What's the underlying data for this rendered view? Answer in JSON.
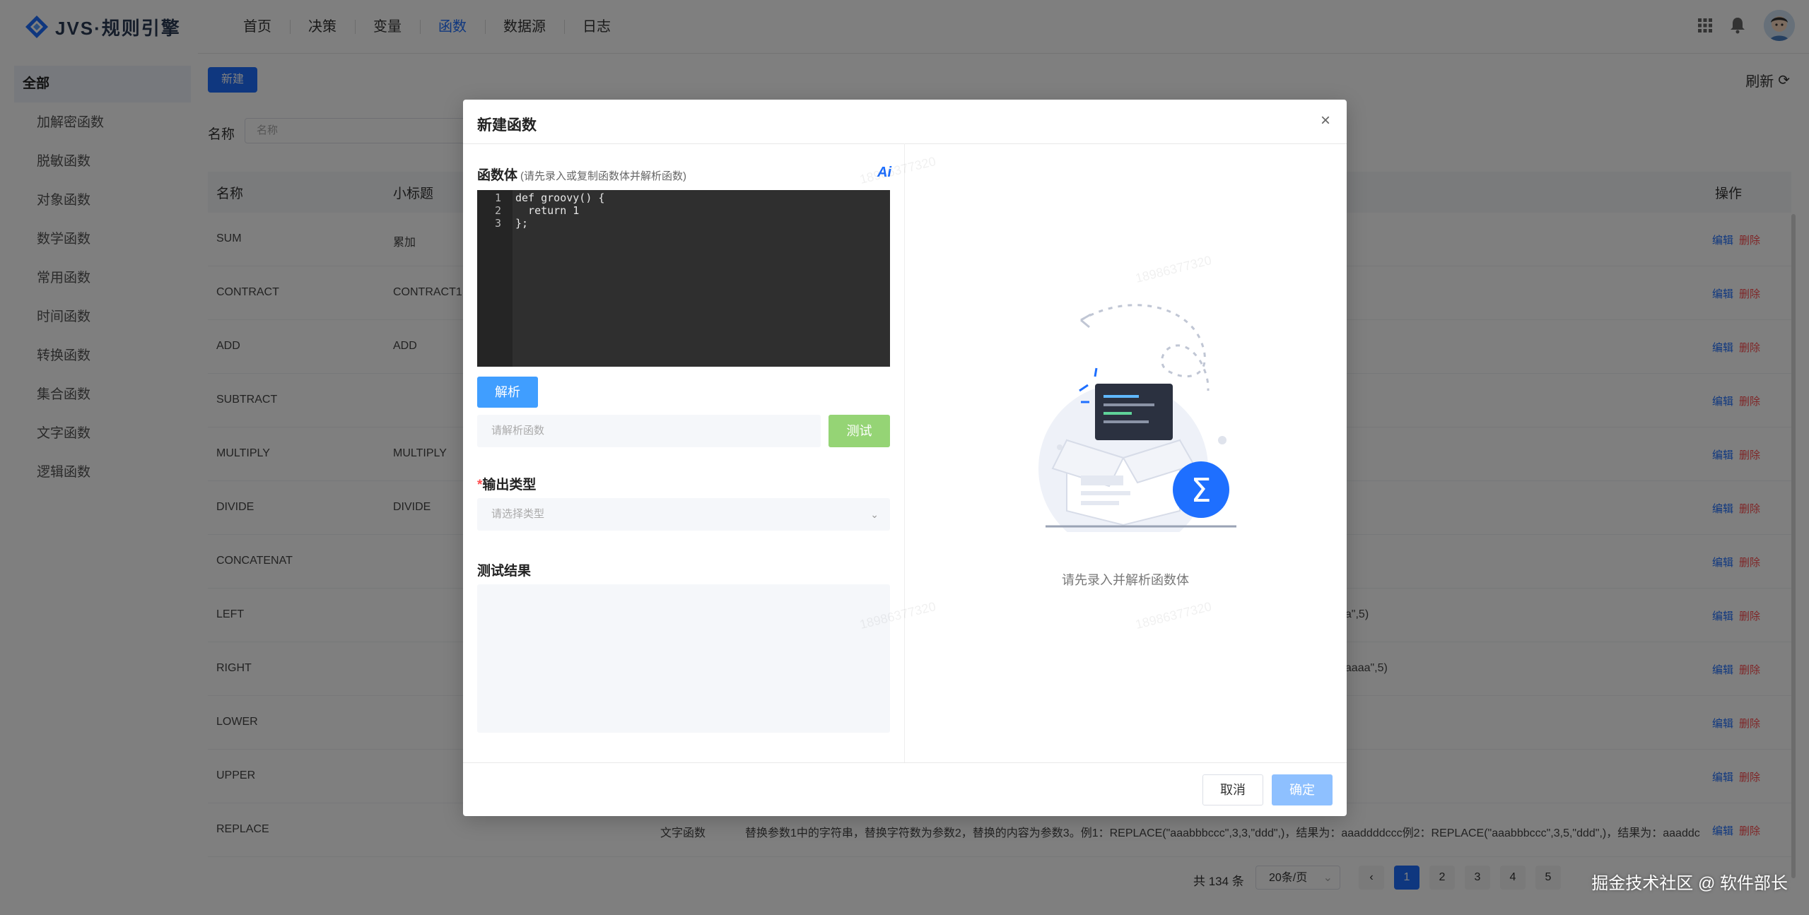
{
  "app": {
    "logo_text": "JVS·规则引擎",
    "nav": [
      "首页",
      "决策",
      "变量",
      "函数",
      "数据源",
      "日志"
    ],
    "active_nav": "函数"
  },
  "sidebar": {
    "items": [
      {
        "label": "全部",
        "active": true
      },
      {
        "label": "加解密函数"
      },
      {
        "label": "脱敏函数"
      },
      {
        "label": "对象函数"
      },
      {
        "label": "数学函数"
      },
      {
        "label": "常用函数"
      },
      {
        "label": "时间函数"
      },
      {
        "label": "转换函数"
      },
      {
        "label": "集合函数"
      },
      {
        "label": "文字函数"
      },
      {
        "label": "逻辑函数"
      }
    ]
  },
  "toolbar": {
    "new_label": "新建",
    "refresh_label": "刷新",
    "name_label": "名称",
    "name_placeholder": "名称"
  },
  "table": {
    "headers": {
      "name": "名称",
      "subtitle": "小标题",
      "ops": "操作"
    },
    "edit_label": "编辑",
    "delete_label": "删除",
    "rows": [
      {
        "name": "SUM",
        "subtitle": "累加"
      },
      {
        "name": "CONTRACT",
        "subtitle": "CONTRACT1"
      },
      {
        "name": "ADD",
        "subtitle": "ADD"
      },
      {
        "name": "SUBTRACT",
        "subtitle": ""
      },
      {
        "name": "MULTIPLY",
        "subtitle": "MULTIPLY"
      },
      {
        "name": "DIVIDE",
        "subtitle": "DIVIDE"
      },
      {
        "name": "CONCATENAT",
        "subtitle": ""
      },
      {
        "name": "LEFT",
        "subtitle": "",
        "tail": "aa\",5)"
      },
      {
        "name": "RIGHT",
        "subtitle": "",
        "tail": "aaaaa\",5)"
      },
      {
        "name": "LOWER",
        "subtitle": ""
      },
      {
        "name": "UPPER",
        "subtitle": ""
      },
      {
        "name": "REPLACE",
        "subtitle": "",
        "category": "文字函数",
        "description": "替换参数1中的字符串，替换字符数为参数2，替换的内容为参数3。例1：REPLACE(\"aaabbbccc\",3,3,\"ddd\",)，结果为：aaaddddccc例2：REPLACE(\"aaabbbccc\",3,5,\"ddd\",)，结果为：aaaddc"
      }
    ]
  },
  "pagination": {
    "total": "共 134 条",
    "page_size": "20条/页",
    "pages": [
      "1",
      "2",
      "3",
      "4",
      "5"
    ],
    "current": "1"
  },
  "modal": {
    "title": "新建函数",
    "body_label": "函数体",
    "body_hint": "(请先录入或复制函数体并解析函数)",
    "ai_label": "Ai",
    "code_lines": [
      {
        "n": "1",
        "text": "def groovy() {"
      },
      {
        "n": "2",
        "text": "  return 1"
      },
      {
        "n": "3",
        "text": "};"
      }
    ],
    "parse_label": "解析",
    "parse_placeholder": "请解析函数",
    "test_label": "测试",
    "output_type_label": "输出类型",
    "output_type_placeholder": "请选择类型",
    "test_result_label": "测试结果",
    "empty_tip": "请先录入并解析函数体",
    "cancel_label": "取消",
    "ok_label": "确定"
  },
  "watermark": "18986377320",
  "credit": "掘金技术社区 @ 软件部长",
  "colors": {
    "primary": "#1e6fff",
    "danger": "#ff4d4f",
    "test_button": "#95d475",
    "ok_button_disabled": "#8ec0ff"
  }
}
